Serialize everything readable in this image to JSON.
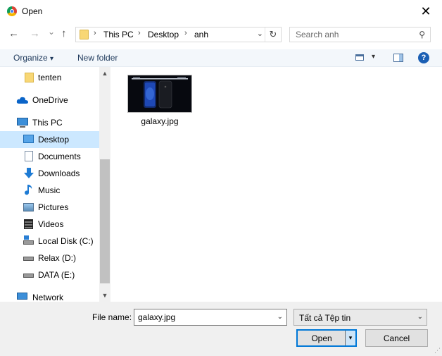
{
  "window": {
    "title": "Open",
    "close_glyph": "✕"
  },
  "nav": {
    "back_glyph": "←",
    "forward_glyph": "→",
    "recent_glyph": "⌄",
    "up_glyph": "↑",
    "breadcrumbs": [
      "This PC",
      "Desktop",
      "anh"
    ],
    "separator": "›",
    "dropdown_glyph": "⌄",
    "refresh_glyph": "↻"
  },
  "search": {
    "placeholder": "Search anh",
    "icon_glyph": "⚲"
  },
  "toolbar": {
    "organize_label": "Organize",
    "organize_drop": "▾",
    "new_folder_label": "New folder",
    "view_drop": "▾",
    "help_glyph": "?"
  },
  "sidebar": {
    "scroll_up": "▲",
    "scroll_down": "▼",
    "items": [
      {
        "label": "tenten",
        "icon": "folder-icon"
      },
      {
        "label": "OneDrive",
        "icon": "cloud-icon"
      },
      {
        "label": "This PC",
        "icon": "computer-icon"
      },
      {
        "label": "Desktop",
        "icon": "desktop-icon",
        "selected": true
      },
      {
        "label": "Documents",
        "icon": "documents-icon"
      },
      {
        "label": "Downloads",
        "icon": "download-icon"
      },
      {
        "label": "Music",
        "icon": "music-icon"
      },
      {
        "label": "Pictures",
        "icon": "pictures-icon"
      },
      {
        "label": "Videos",
        "icon": "videos-icon"
      },
      {
        "label": "Local Disk (C:)",
        "icon": "drive-icon"
      },
      {
        "label": "Relax (D:)",
        "icon": "drive-icon"
      },
      {
        "label": "DATA (E:)",
        "icon": "drive-icon"
      },
      {
        "label": "Network",
        "icon": "network-icon"
      }
    ]
  },
  "files": [
    {
      "name": "galaxy.jpg",
      "icon": "image-thumbnail"
    }
  ],
  "footer": {
    "file_name_label": "File name:",
    "file_name_value": "galaxy.jpg",
    "file_type_value": "Tất cả Tệp tin",
    "dropdown_glyph": "⌄",
    "open_label": "Open",
    "open_split_glyph": "▾",
    "cancel_label": "Cancel",
    "grip_glyph": "⋰"
  },
  "colors": {
    "selection": "#cce8ff",
    "accent": "#0078d7",
    "help": "#1a5fb4"
  }
}
